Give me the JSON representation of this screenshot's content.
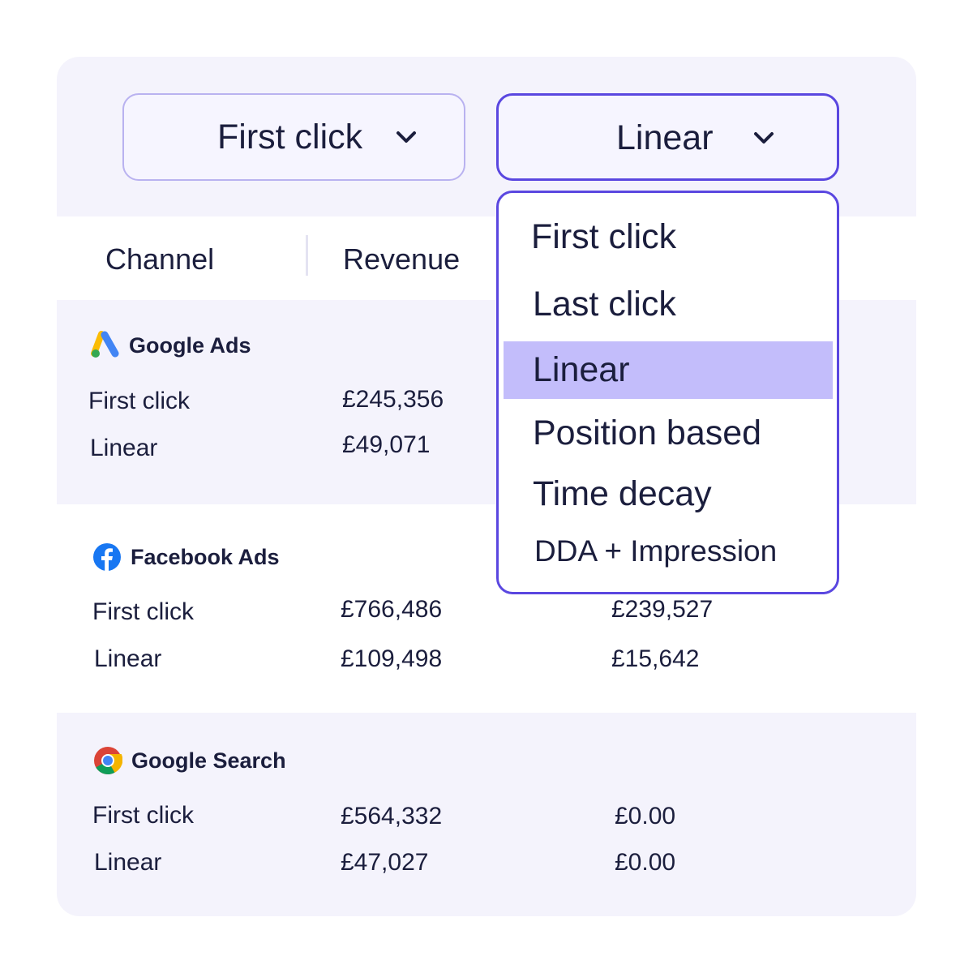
{
  "attribution": {
    "left_select": {
      "value": "First click",
      "icon": "chevron-down-icon"
    },
    "right_select": {
      "value": "Linear",
      "icon": "chevron-down-icon"
    },
    "menu": {
      "options": [
        "First click",
        "Last click",
        "Linear",
        "Position based",
        "Time decay",
        "DDA + Impression"
      ],
      "selected": "Linear"
    }
  },
  "table": {
    "headers": [
      "Channel",
      "Revenue"
    ],
    "channels": [
      {
        "name": "Google Ads",
        "icon": "google-ads-icon",
        "rows": [
          {
            "model": "First click",
            "revenue": "£245,356",
            "value": ""
          },
          {
            "model": "Linear",
            "revenue": "£49,071",
            "value": ""
          }
        ]
      },
      {
        "name": "Facebook Ads",
        "icon": "facebook-icon",
        "rows": [
          {
            "model": "First click",
            "revenue": "£766,486",
            "value": "£239,527"
          },
          {
            "model": "Linear",
            "revenue": "£109,498",
            "value": "£15,642"
          }
        ]
      },
      {
        "name": "Google Search",
        "icon": "chrome-icon",
        "rows": [
          {
            "model": "First click",
            "revenue": "£564,332",
            "value": "£0.00"
          },
          {
            "model": "Linear",
            "revenue": "£47,027",
            "value": "£0.00"
          }
        ]
      }
    ]
  },
  "colors": {
    "accent": "#5a47e0",
    "selected_bg": "#c3bdfb",
    "card_bg": "#f4f3fc",
    "text": "#1b1e3d"
  }
}
